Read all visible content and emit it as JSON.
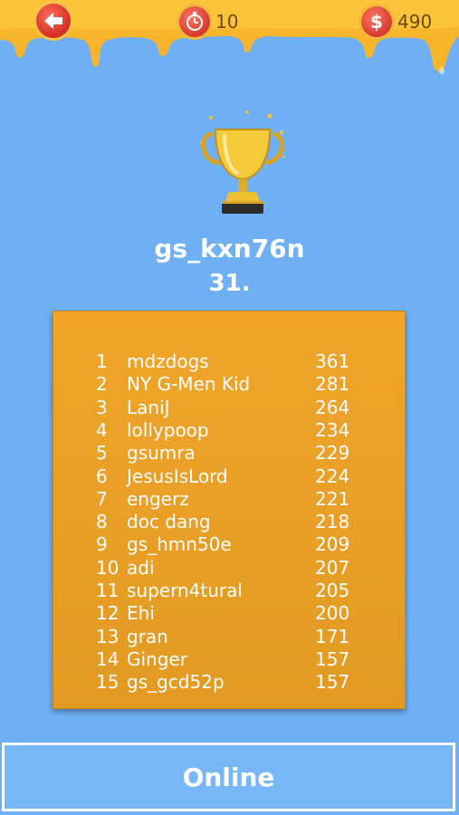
{
  "header": {
    "timer_value": "10",
    "money_value": "490",
    "accent": "#f5b93a",
    "icons": [
      "back-arrow-icon",
      "stopwatch-icon",
      "dollar-icon"
    ]
  },
  "player": {
    "username": "gs_kxn76n",
    "rank": "31."
  },
  "leaderboard": {
    "rows": [
      {
        "num": "1",
        "name": "mdzdogs",
        "score": "361"
      },
      {
        "num": "2",
        "name": "NY G-Men Kid",
        "score": "281"
      },
      {
        "num": "3",
        "name": "LaniJ",
        "score": "264"
      },
      {
        "num": "4",
        "name": "lollypoop",
        "score": "234"
      },
      {
        "num": "5",
        "name": "gsumra",
        "score": "229"
      },
      {
        "num": "6",
        "name": "JesusIsLord",
        "score": "224"
      },
      {
        "num": "7",
        "name": "engerz",
        "score": "221"
      },
      {
        "num": "8",
        "name": "doc dang",
        "score": "218"
      },
      {
        "num": "9",
        "name": "gs_hmn50e",
        "score": "209"
      },
      {
        "num": "10",
        "name": "adi",
        "score": "207"
      },
      {
        "num": "11",
        "name": "supern4tural",
        "score": "205"
      },
      {
        "num": "12",
        "name": "Ehi",
        "score": "200"
      },
      {
        "num": "13",
        "name": "gran",
        "score": "171"
      },
      {
        "num": "14",
        "name": "Ginger",
        "score": "157"
      },
      {
        "num": "15",
        "name": "gs_gcd52p",
        "score": "157"
      }
    ]
  },
  "footer": {
    "online_label": "Online"
  }
}
